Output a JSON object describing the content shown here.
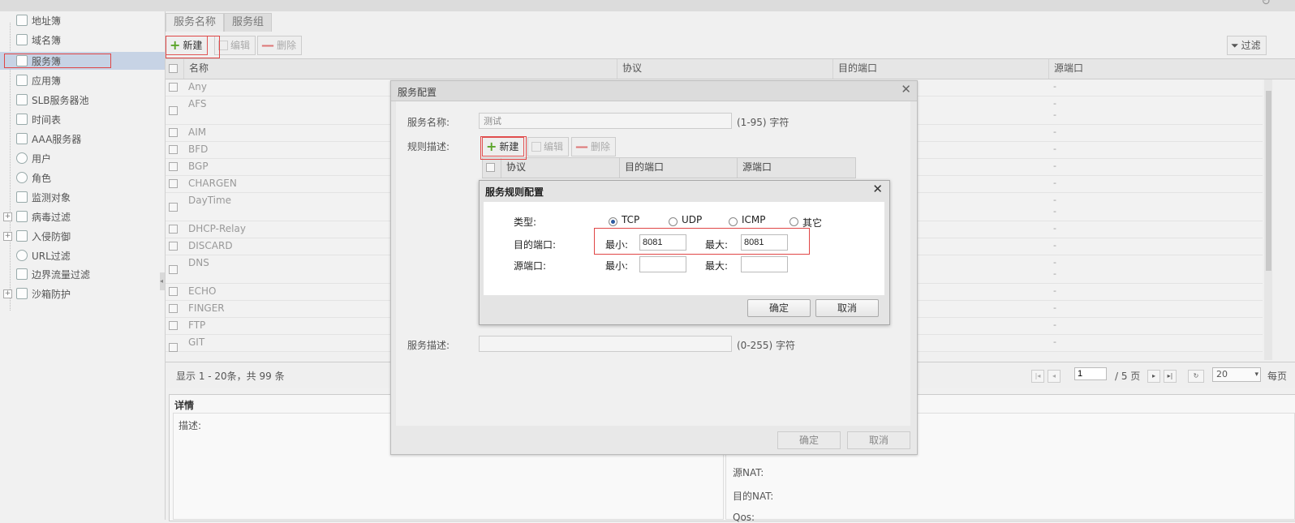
{
  "sidebar": {
    "items": [
      {
        "label": "地址簿"
      },
      {
        "label": "域名簿"
      },
      {
        "label": "服务簿"
      },
      {
        "label": "应用簿"
      },
      {
        "label": "SLB服务器池"
      },
      {
        "label": "时间表"
      },
      {
        "label": "AAA服务器"
      },
      {
        "label": "用户"
      },
      {
        "label": "角色"
      },
      {
        "label": "监测对象"
      },
      {
        "label": "病毒过滤"
      },
      {
        "label": "入侵防御"
      },
      {
        "label": "URL过滤"
      },
      {
        "label": "边界流量过滤"
      },
      {
        "label": "沙箱防护"
      }
    ],
    "selected": "服务簿"
  },
  "tabs": [
    {
      "label": "服务名称"
    },
    {
      "label": "服务组"
    }
  ],
  "toolbar": {
    "new": "新建",
    "edit": "编辑",
    "delete": "删除",
    "filter": "过滤"
  },
  "grid": {
    "columns": [
      "名称",
      "协议",
      "目的端口",
      "源端口"
    ],
    "rows": [
      {
        "name": "Any",
        "src": "-"
      },
      {
        "name": "AFS",
        "src": "-\n-"
      },
      {
        "name": "AIM",
        "src": "-"
      },
      {
        "name": "BFD",
        "src": "-"
      },
      {
        "name": "BGP",
        "src": "-"
      },
      {
        "name": "CHARGEN",
        "src": "-"
      },
      {
        "name": "DayTime",
        "src": "-\n-"
      },
      {
        "name": "DHCP-Relay",
        "src": "-"
      },
      {
        "name": "DISCARD",
        "src": "-"
      },
      {
        "name": "DNS",
        "src": "-\n-"
      },
      {
        "name": "ECHO",
        "src": "-"
      },
      {
        "name": "FINGER",
        "src": "-"
      },
      {
        "name": "FTP",
        "src": "-"
      },
      {
        "name": "GIT",
        "src": "-"
      }
    ]
  },
  "pager": {
    "summary": "显示 1 - 20条，共 99 条",
    "page": "1",
    "total": "/ 5 页",
    "per_page": "20",
    "per_page_label": "每页"
  },
  "detail": {
    "title": "详情",
    "desc_label": "描述:",
    "right": [
      "源NAT:",
      "目的NAT:",
      "Qos:"
    ]
  },
  "dialog_service": {
    "title": "服务配置",
    "name_label": "服务名称:",
    "name_value": "测试",
    "name_hint": "(1-95) 字符",
    "rules_label": "规则描述:",
    "new": "新建",
    "edit": "编辑",
    "delete": "删除",
    "rule_columns": [
      "协议",
      "目的端口",
      "源端口"
    ],
    "desc_label": "服务描述:",
    "desc_hint": "(0-255) 字符",
    "ok": "确定",
    "cancel": "取消"
  },
  "dialog_rule": {
    "title": "服务规则配置",
    "type_label": "类型:",
    "types": [
      "TCP",
      "UDP",
      "ICMP",
      "其它"
    ],
    "selected_type": "TCP",
    "dst_label": "目的端口:",
    "src_label": "源端口:",
    "min_label": "最小:",
    "max_label": "最大:",
    "dst_min": "8081",
    "dst_max": "8081",
    "src_min": "",
    "src_max": "",
    "ok": "确定",
    "cancel": "取消"
  }
}
